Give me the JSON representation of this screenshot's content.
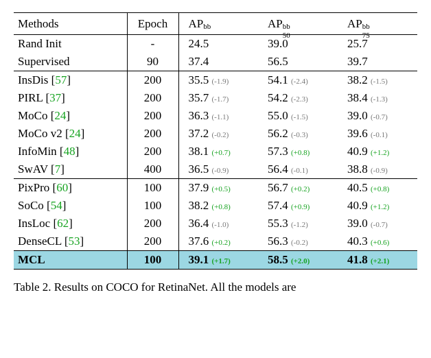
{
  "header": {
    "methods": "Methods",
    "epoch": "Epoch",
    "ap_base": "AP",
    "ap_sup": "bb",
    "ap50_sub": "50",
    "ap75_sub": "75"
  },
  "chart_data": {
    "type": "table",
    "title": "Table 2",
    "columns": [
      "Methods",
      "Epoch",
      "AP_bb",
      "AP_bb_50",
      "AP_bb_75"
    ],
    "sections": [
      {
        "rows": [
          {
            "method": "Rand Init",
            "cite": null,
            "epoch": "-",
            "ap": 24.5,
            "ap_d": null,
            "ap50": 39.0,
            "ap50_d": null,
            "ap75": 25.7,
            "ap75_d": null
          },
          {
            "method": "Supervised",
            "cite": null,
            "epoch": "90",
            "ap": 37.4,
            "ap_d": null,
            "ap50": 56.5,
            "ap50_d": null,
            "ap75": 39.7,
            "ap75_d": null
          }
        ]
      },
      {
        "rows": [
          {
            "method": "InsDis",
            "cite": "57",
            "epoch": "200",
            "ap": 35.5,
            "ap_d": -1.9,
            "ap50": 54.1,
            "ap50_d": -2.4,
            "ap75": 38.2,
            "ap75_d": -1.5
          },
          {
            "method": "PIRL",
            "cite": "37",
            "epoch": "200",
            "ap": 35.7,
            "ap_d": -1.7,
            "ap50": 54.2,
            "ap50_d": -2.3,
            "ap75": 38.4,
            "ap75_d": -1.3
          },
          {
            "method": "MoCo",
            "cite": "24",
            "epoch": "200",
            "ap": 36.3,
            "ap_d": -1.1,
            "ap50": 55.0,
            "ap50_d": -1.5,
            "ap75": 39.0,
            "ap75_d": -0.7
          },
          {
            "method": "MoCo v2",
            "cite": "24",
            "epoch": "200",
            "ap": 37.2,
            "ap_d": -0.2,
            "ap50": 56.2,
            "ap50_d": -0.3,
            "ap75": 39.6,
            "ap75_d": -0.1
          },
          {
            "method": "InfoMin",
            "cite": "48",
            "epoch": "200",
            "ap": 38.1,
            "ap_d": 0.7,
            "ap50": 57.3,
            "ap50_d": 0.8,
            "ap75": 40.9,
            "ap75_d": 1.2
          },
          {
            "method": "SwAV",
            "cite": "7",
            "epoch": "400",
            "ap": 36.5,
            "ap_d": -0.9,
            "ap50": 56.4,
            "ap50_d": -0.1,
            "ap75": 38.8,
            "ap75_d": -0.9
          }
        ]
      },
      {
        "rows": [
          {
            "method": "PixPro",
            "cite": "60",
            "epoch": "100",
            "ap": 37.9,
            "ap_d": 0.5,
            "ap50": 56.7,
            "ap50_d": 0.2,
            "ap75": 40.5,
            "ap75_d": 0.8
          },
          {
            "method": "SoCo",
            "cite": "54",
            "epoch": "100",
            "ap": 38.2,
            "ap_d": 0.8,
            "ap50": 57.4,
            "ap50_d": 0.9,
            "ap75": 40.9,
            "ap75_d": 1.2
          },
          {
            "method": "InsLoc",
            "cite": "62",
            "epoch": "200",
            "ap": 36.4,
            "ap_d": -1.0,
            "ap50": 55.3,
            "ap50_d": -1.2,
            "ap75": 39.0,
            "ap75_d": -0.7
          },
          {
            "method": "DenseCL",
            "cite": "53",
            "epoch": "200",
            "ap": 37.6,
            "ap_d": 0.2,
            "ap50": 56.3,
            "ap50_d": -0.2,
            "ap75": 40.3,
            "ap75_d": 0.6
          }
        ]
      },
      {
        "highlight": true,
        "rows": [
          {
            "method": "MCL",
            "cite": null,
            "epoch": "100",
            "ap": 39.1,
            "ap_d": 1.7,
            "ap50": 58.5,
            "ap50_d": 2.0,
            "ap75": 41.8,
            "ap75_d": 2.1
          }
        ]
      }
    ]
  },
  "caption": {
    "prefix": "Table 2. ",
    "rest_visible": "Results on COCO for RetinaNet. All the models are"
  }
}
